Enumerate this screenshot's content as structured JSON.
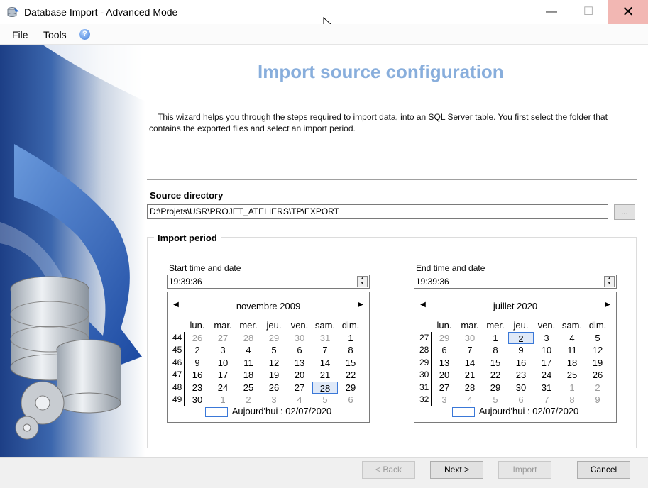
{
  "window": {
    "title": "Database Import - Advanced Mode",
    "minimize": "—",
    "maximize": "☐",
    "close": "✕"
  },
  "menu": {
    "items": [
      "File",
      "Tools"
    ],
    "help_icon": "?"
  },
  "main": {
    "title": "Import source configuration",
    "intro": "This wizard helps you through the steps required to import data, into an SQL Server table. You first select the folder that contains the exported files and select an import period."
  },
  "source": {
    "label": "Source directory",
    "path": "D:\\Projets\\USR\\PROJET_ATELIERS\\TP\\EXPORT",
    "browse": "..."
  },
  "period": {
    "label": "Import period",
    "start": {
      "label": "Start time and date",
      "time": "19:39:36",
      "month": "novembre 2009",
      "days": [
        "lun.",
        "mar.",
        "mer.",
        "jeu.",
        "ven.",
        "sam.",
        "dim."
      ],
      "weeks": [
        {
          "wk": "44",
          "d": [
            "26",
            "27",
            "28",
            "29",
            "30",
            "31",
            "1"
          ]
        },
        {
          "wk": "45",
          "d": [
            "2",
            "3",
            "4",
            "5",
            "6",
            "7",
            "8"
          ]
        },
        {
          "wk": "46",
          "d": [
            "9",
            "10",
            "11",
            "12",
            "13",
            "14",
            "15"
          ]
        },
        {
          "wk": "47",
          "d": [
            "16",
            "17",
            "18",
            "19",
            "20",
            "21",
            "22"
          ]
        },
        {
          "wk": "48",
          "d": [
            "23",
            "24",
            "25",
            "26",
            "27",
            "28",
            "29"
          ]
        },
        {
          "wk": "49",
          "d": [
            "30",
            "1",
            "2",
            "3",
            "4",
            "5",
            "6"
          ]
        }
      ],
      "selected": "28",
      "today": "Aujourd'hui : 02/07/2020"
    },
    "end": {
      "label": "End time and date",
      "time": "19:39:36",
      "month": "juillet 2020",
      "days": [
        "lun.",
        "mar.",
        "mer.",
        "jeu.",
        "ven.",
        "sam.",
        "dim."
      ],
      "weeks": [
        {
          "wk": "27",
          "d": [
            "29",
            "30",
            "1",
            "2",
            "3",
            "4",
            "5"
          ]
        },
        {
          "wk": "28",
          "d": [
            "6",
            "7",
            "8",
            "9",
            "10",
            "11",
            "12"
          ]
        },
        {
          "wk": "29",
          "d": [
            "13",
            "14",
            "15",
            "16",
            "17",
            "18",
            "19"
          ]
        },
        {
          "wk": "30",
          "d": [
            "20",
            "21",
            "22",
            "23",
            "24",
            "25",
            "26"
          ]
        },
        {
          "wk": "31",
          "d": [
            "27",
            "28",
            "29",
            "30",
            "31",
            "1",
            "2"
          ]
        },
        {
          "wk": "32",
          "d": [
            "3",
            "4",
            "5",
            "6",
            "7",
            "8",
            "9"
          ]
        }
      ],
      "selected": "2",
      "today": "Aujourd'hui : 02/07/2020"
    }
  },
  "buttons": {
    "back": "< Back",
    "next": "Next >",
    "import": "Import",
    "cancel": "Cancel"
  }
}
